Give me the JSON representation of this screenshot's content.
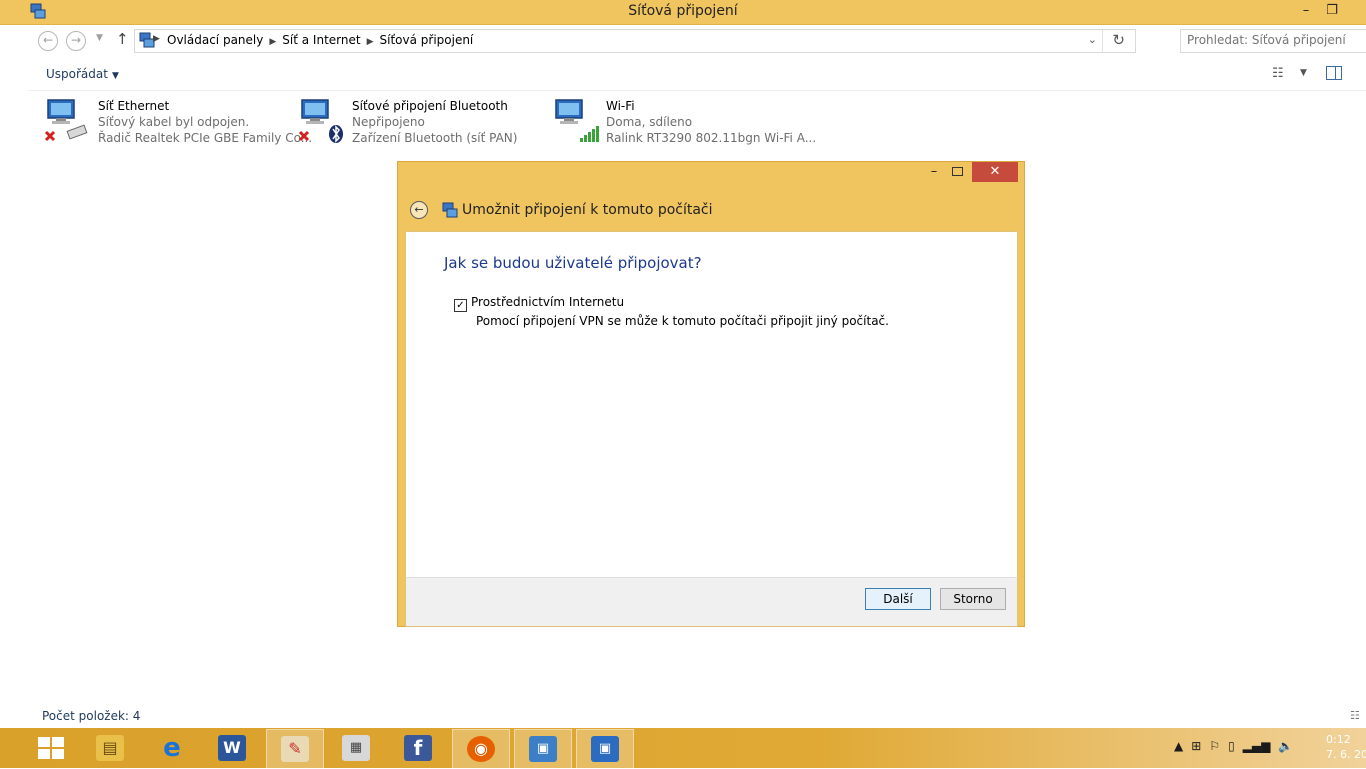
{
  "window": {
    "title": "Síťová připojení",
    "minimize_glyph": "–",
    "restore_glyph": "❐"
  },
  "address": {
    "breadcrumbs": [
      "Ovládací panely",
      "Síť a Internet",
      "Síťová připojení"
    ],
    "search_placeholder": "Prohledat: Síťová připojení"
  },
  "toolbar": {
    "organize_label": "Uspořádat"
  },
  "connections": [
    {
      "name": "Síť Ethernet",
      "status": "Síťový kabel byl odpojen.",
      "device": "Řadič Realtek PCIe GBE Family Co...",
      "state": "disconnected"
    },
    {
      "name": "Síťové připojení Bluetooth",
      "status": "Nepřipojeno",
      "device": "Zařízení Bluetooth (síť PAN)",
      "state": "disconnected"
    },
    {
      "name": "Wi-Fi",
      "status": "Doma, sdíleno",
      "device": "Ralink RT3290 802.11bgn Wi-Fi A...",
      "state": "connected"
    }
  ],
  "statusbar": {
    "item_count": "Počet položek: 4"
  },
  "dialog": {
    "title": "Umožnit připojení k tomuto počítači",
    "heading": "Jak se budou uživatelé připojovat?",
    "checkbox_label": "Prostřednictvím Internetu",
    "checkbox_checked": true,
    "checkbox_description": "Pomocí připojení VPN se může k tomuto počítači připojit jiný počítač.",
    "next_label": "Další",
    "cancel_label": "Storno",
    "close_glyph": "✕",
    "minimize_glyph": "–"
  },
  "taskbar": {
    "apps": [
      "file-explorer",
      "internet-explorer",
      "word",
      "paint",
      "calculator",
      "facebook",
      "firefox",
      "remote-desktop",
      "network-connections"
    ],
    "clock_time": "0:12",
    "clock_date": "7. 6. 20"
  },
  "colors": {
    "accent": "#f0c560",
    "close_red": "#c74b3c",
    "heading_blue": "#1c3a8d"
  }
}
